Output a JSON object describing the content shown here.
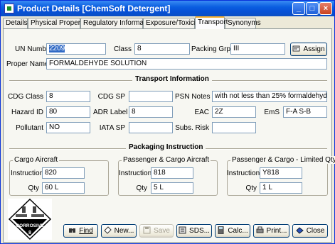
{
  "window": {
    "title": "Product Details [ChemSoft Detergent]"
  },
  "tabs": [
    {
      "label": "Details"
    },
    {
      "label": "Physical Properties"
    },
    {
      "label": "Regulatory Information"
    },
    {
      "label": "Exposure/Toxicity"
    },
    {
      "label": "Transport"
    },
    {
      "label": "Synonyms"
    }
  ],
  "header": {
    "un_label": "UN Numb",
    "un_value": "2209",
    "class_label": "Class",
    "class_value": "8",
    "packing_label": "Packing Grp",
    "packing_value": "III",
    "assign_label": "Assign",
    "proper_name_label": "Proper Name",
    "proper_name_value": "FORMALDEHYDE SOLUTION"
  },
  "transport": {
    "section_title": "Transport Information",
    "cdg_class_label": "CDG Class",
    "cdg_class_value": "8",
    "cdg_sp_label": "CDG SP",
    "cdg_sp_value": "",
    "psn_notes_label": "PSN Notes",
    "psn_notes_value": "with not less than 25% formaldehyde",
    "hazard_id_label": "Hazard ID",
    "hazard_id_value": "80",
    "adr_label_label": "ADR Label",
    "adr_label_value": "8",
    "eac_label": "EAC",
    "eac_value": "2Z",
    "ems_label": "EmS",
    "ems_value": "F-A S-B",
    "pollutant_label": "Pollutant",
    "pollutant_value": "NO",
    "iata_sp_label": "IATA SP",
    "iata_sp_value": "",
    "subs_risk_label": "Subs. Risk",
    "subs_risk_value": ""
  },
  "packaging": {
    "section_title": "Packaging Instruction",
    "groups": [
      {
        "title": "Cargo Aircraft",
        "instruction_label": "Instruction",
        "instruction_value": "820",
        "qty_label": "Qty",
        "qty_value": "60 L"
      },
      {
        "title": "Passenger & Cargo Aircraft",
        "instruction_label": "Instruction",
        "instruction_value": "818",
        "qty_label": "Qty",
        "qty_value": "5 L"
      },
      {
        "title": "Passenger & Cargo - Limited Qty",
        "instruction_label": "Instruction",
        "instruction_value": "Y818",
        "qty_label": "Qty",
        "qty_value": "1 L"
      }
    ]
  },
  "hazard_label": {
    "text": "CORROSIVE",
    "class": "8"
  },
  "buttons": {
    "find": "Find",
    "new": "New...",
    "save": "Save",
    "sds": "SDS...",
    "calc": "Calc...",
    "print": "Print...",
    "close": "Close"
  },
  "colors": {
    "titlebar": "#0a5ee0",
    "active_tab_accent": "#f7b02e",
    "selection": "#316ac5"
  },
  "icons": [
    "app-icon",
    "minimize-icon",
    "maximize-icon",
    "close-icon",
    "assign-icon",
    "find-icon",
    "new-icon",
    "save-icon",
    "sds-icon",
    "calc-icon",
    "print-icon",
    "close-door-icon",
    "corrosive-hazard-icon"
  ]
}
